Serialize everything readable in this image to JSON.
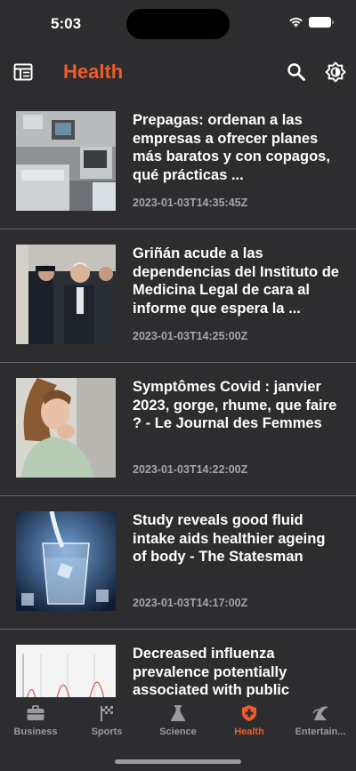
{
  "status_bar": {
    "time": "5:03"
  },
  "header": {
    "title": "Health",
    "accent_color": "#ef5b2b",
    "left_icon": "layout-icon",
    "search_icon": "search-icon",
    "theme_icon": "brightness-icon"
  },
  "articles": [
    {
      "title": "Prepagas: ordenan a las empresas a ofrecer planes más baratos y con copagos, qué prácticas ...",
      "date": "2023-01-03T14:35:45Z",
      "thumb": "hospital-room-image"
    },
    {
      "title": "Griñán acude a las dependencias del Instituto de Medicina Legal de cara al informe que espera la ...",
      "date": "2023-01-03T14:25:00Z",
      "thumb": "officials-walking-image"
    },
    {
      "title": "Symptômes Covid : janvier 2023, gorge, rhume, que faire ? - Le Journal des Femmes",
      "date": "2023-01-03T14:22:00Z",
      "thumb": "woman-coughing-image"
    },
    {
      "title": "Study reveals good fluid intake aids healthier ageing of body - The Statesman",
      "date": "2023-01-03T14:17:00Z",
      "thumb": "water-glass-image"
    },
    {
      "title": "Decreased influenza prevalence potentially associated with public",
      "date": "",
      "thumb": "chart-image"
    }
  ],
  "tabs": [
    {
      "label": "Business",
      "icon": "briefcase-icon",
      "active": false
    },
    {
      "label": "Sports",
      "icon": "flag-icon",
      "active": false
    },
    {
      "label": "Science",
      "icon": "flask-icon",
      "active": false
    },
    {
      "label": "Health",
      "icon": "medical-icon",
      "active": true
    },
    {
      "label": "Entertain...",
      "icon": "entertainment-icon",
      "active": false
    }
  ]
}
